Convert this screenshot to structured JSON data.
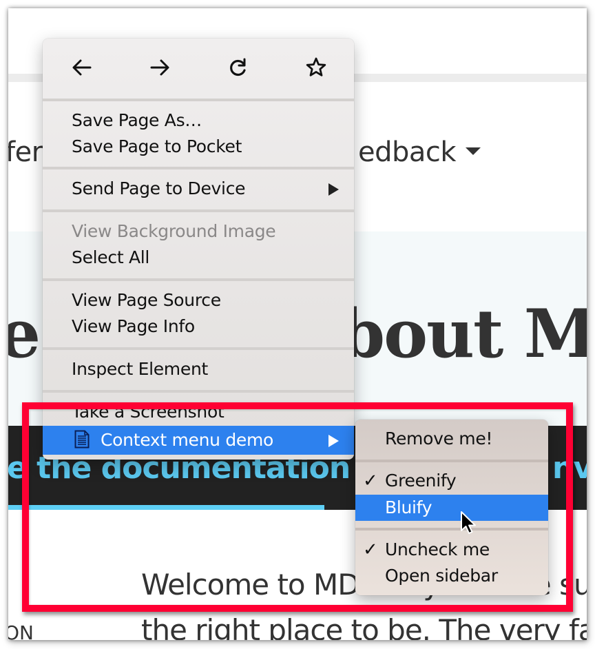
{
  "page": {
    "nav_left_fragment": "fer",
    "nav_right_fragment": "edback",
    "hero_left_fragment": "e",
    "hero_right_fragment": "bout M",
    "doc_link_left": "e the documentation",
    "doc_link_right": "nve",
    "body_line1": "Welcome to MDN. If you have sug",
    "body_line2": "the right place to be. The very fact",
    "side_fragment": "ON",
    "colors": {
      "link_blue": "#5bc8ef",
      "dark_band": "#222222",
      "hero_bg": "#f4f9fa"
    }
  },
  "context_menu": {
    "nav_buttons": [
      {
        "name": "back",
        "icon": "arrow-left-icon"
      },
      {
        "name": "forward",
        "icon": "arrow-right-icon"
      },
      {
        "name": "reload",
        "icon": "reload-icon"
      },
      {
        "name": "bookmark",
        "icon": "star-icon"
      }
    ],
    "items": {
      "save_page_as": "Save Page As…",
      "save_to_pocket": "Save Page to Pocket",
      "send_to_device": "Send Page to Device",
      "view_bg_image": "View Background Image",
      "select_all": "Select All",
      "view_source": "View Page Source",
      "view_info": "View Page Info",
      "inspect": "Inspect Element",
      "screenshot": "Take a Screenshot",
      "extension_demo": "Context menu demo"
    },
    "highlight_color": "#2d81ee"
  },
  "submenu": {
    "items": {
      "remove_me": "Remove me!",
      "greenify": "Greenify",
      "bluify": "Bluify",
      "uncheck_me": "Uncheck me",
      "open_sidebar": "Open sidebar"
    },
    "check_glyph": "✓",
    "greenify_checked": true,
    "uncheck_me_checked": true
  },
  "annotation": {
    "frame_color": "#ff0033"
  }
}
